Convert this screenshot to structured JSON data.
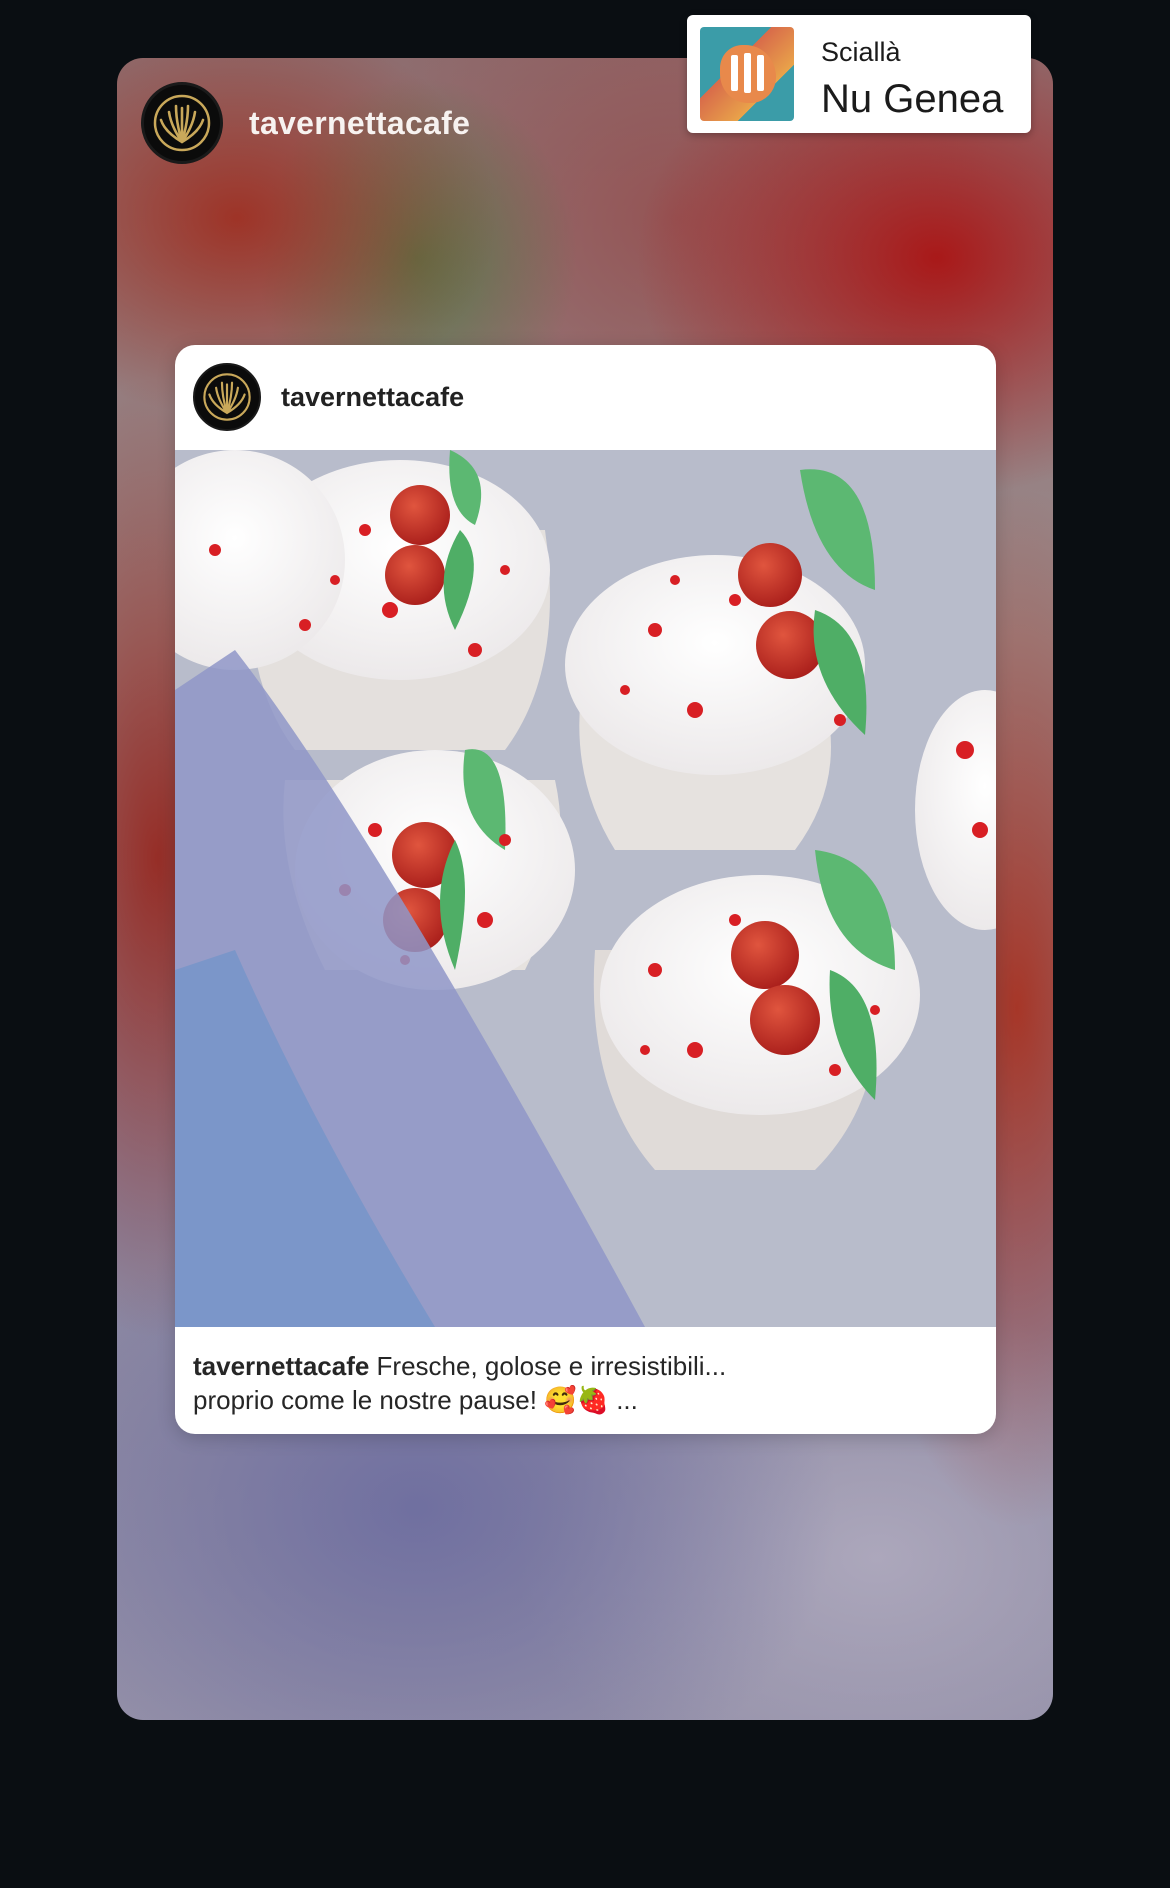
{
  "story": {
    "username": "tavernettacafe",
    "avatar_icon": "gold-shell-logo-icon"
  },
  "music_sticker": {
    "title": "Sciallà",
    "artist": "Nu Genea",
    "album_icon": "album-cover-icon"
  },
  "post": {
    "username": "tavernettacafe",
    "avatar_icon": "gold-shell-logo-icon",
    "image_subject": "strawberry-cream-dessert-cups-photo",
    "caption_username": "tavernettacafe",
    "caption_text": "Fresche, golose e irresistibili...",
    "caption_text_line2": "proprio come le nostre pause!",
    "caption_emoji": "🥰🍓",
    "caption_more": "..."
  },
  "colors": {
    "background": "#0a0e12",
    "post_card": "#ffffff",
    "logo_gold": "#c9a85a"
  }
}
